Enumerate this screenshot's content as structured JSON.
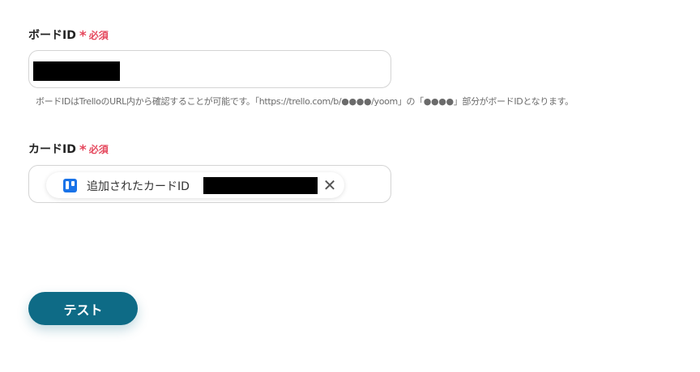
{
  "board_field": {
    "label": "ボードID",
    "required_mark": "*",
    "required_text": "必須",
    "value_redacted": true,
    "help_text": "ボードIDはTrelloのURL内から確認することが可能です。「https://trello.com/b/●●●●/yoom」の「●●●●」部分がボードIDとなります。"
  },
  "card_field": {
    "label": "カードID",
    "required_mark": "*",
    "required_text": "必須",
    "chip": {
      "icon": "trello-icon",
      "label": "追加されたカードID",
      "value_redacted": true,
      "close_icon": "close-icon",
      "close_glyph": "✕"
    }
  },
  "actions": {
    "test_label": "テスト"
  },
  "colors": {
    "required": "#e5485d",
    "primary_button": "#0e6b86",
    "trello": "#1a73e8",
    "border": "#d4d4d4",
    "help_text": "#6b6b6b"
  }
}
